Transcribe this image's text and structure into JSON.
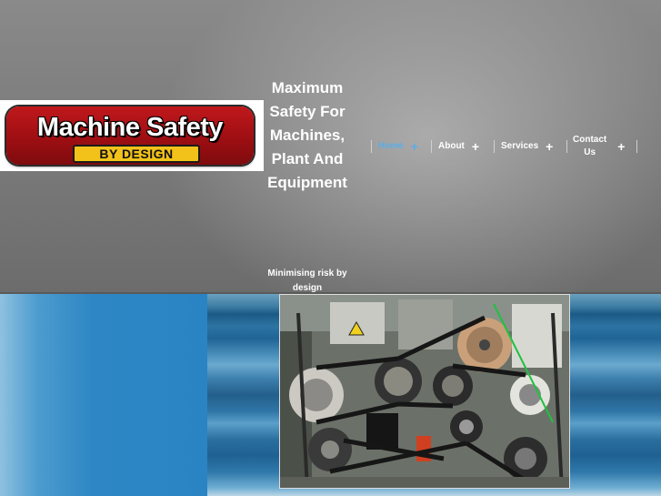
{
  "logo": {
    "title": "Machine Safety",
    "subtitle": "BY DESIGN"
  },
  "tagline": {
    "line1": "Maximum",
    "line2": "Safety For",
    "line3": "Machines,",
    "line4": "Plant And",
    "line5": "Equipment"
  },
  "subtag": {
    "line1": "Minimising risk by",
    "line2": "design"
  },
  "nav": {
    "items": [
      {
        "label": "Home",
        "active": true
      },
      {
        "label": "About"
      },
      {
        "label": "Services"
      },
      {
        "label_line1": "Contact",
        "label_line2": "Us"
      }
    ],
    "plus": "+"
  },
  "colors": {
    "active_nav": "#5aaee8",
    "logo_red": "#b0141a",
    "logo_yellow": "#f2c21a",
    "content_blue": "#2a84c3"
  },
  "icons": {
    "nav_expand": "plus-icon"
  }
}
